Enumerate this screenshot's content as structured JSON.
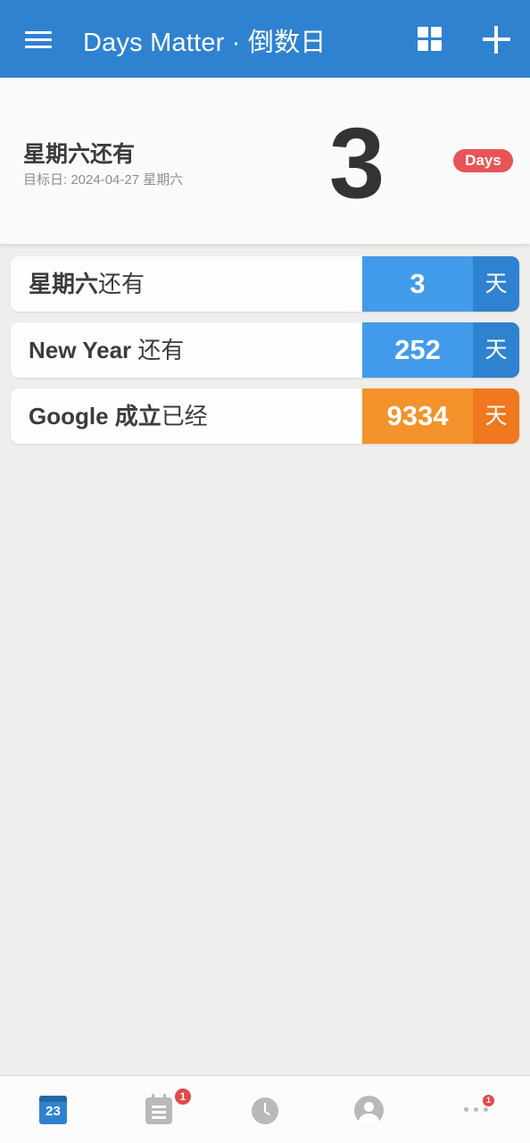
{
  "app_bar": {
    "title": "Days Matter · 倒数日",
    "menu_icon": "hamburger-menu-icon",
    "grid_icon": "grid-view-icon",
    "add_icon": "plus-icon",
    "color": "#2f82cf"
  },
  "hero": {
    "title": "星期六还有",
    "subtitle": "目标日: 2024-04-27 星期六",
    "count": "3",
    "badge": "Days",
    "badge_color": "#e85456"
  },
  "events": [
    {
      "name_bold": "星期六",
      "name_rest": "还有",
      "count": "3",
      "unit": "天",
      "count_color": "#429bea",
      "unit_color": "#2f82cf"
    },
    {
      "name_bold": "New Year",
      "name_rest": " 还有",
      "count": "252",
      "unit": "天",
      "count_color": "#429bea",
      "unit_color": "#2f82cf"
    },
    {
      "name_bold": "Google 成立",
      "name_rest": "已经",
      "count": "9334",
      "unit": "天",
      "count_color": "#f4922c",
      "unit_color": "#f0781e"
    }
  ],
  "bottom_nav": {
    "tabs": [
      {
        "icon": "calendar-icon",
        "text": "23",
        "active": true
      },
      {
        "icon": "list-icon",
        "badge": "1"
      },
      {
        "icon": "clock-icon"
      },
      {
        "icon": "profile-icon"
      },
      {
        "icon": "more-icon",
        "badge": "1"
      }
    ]
  }
}
